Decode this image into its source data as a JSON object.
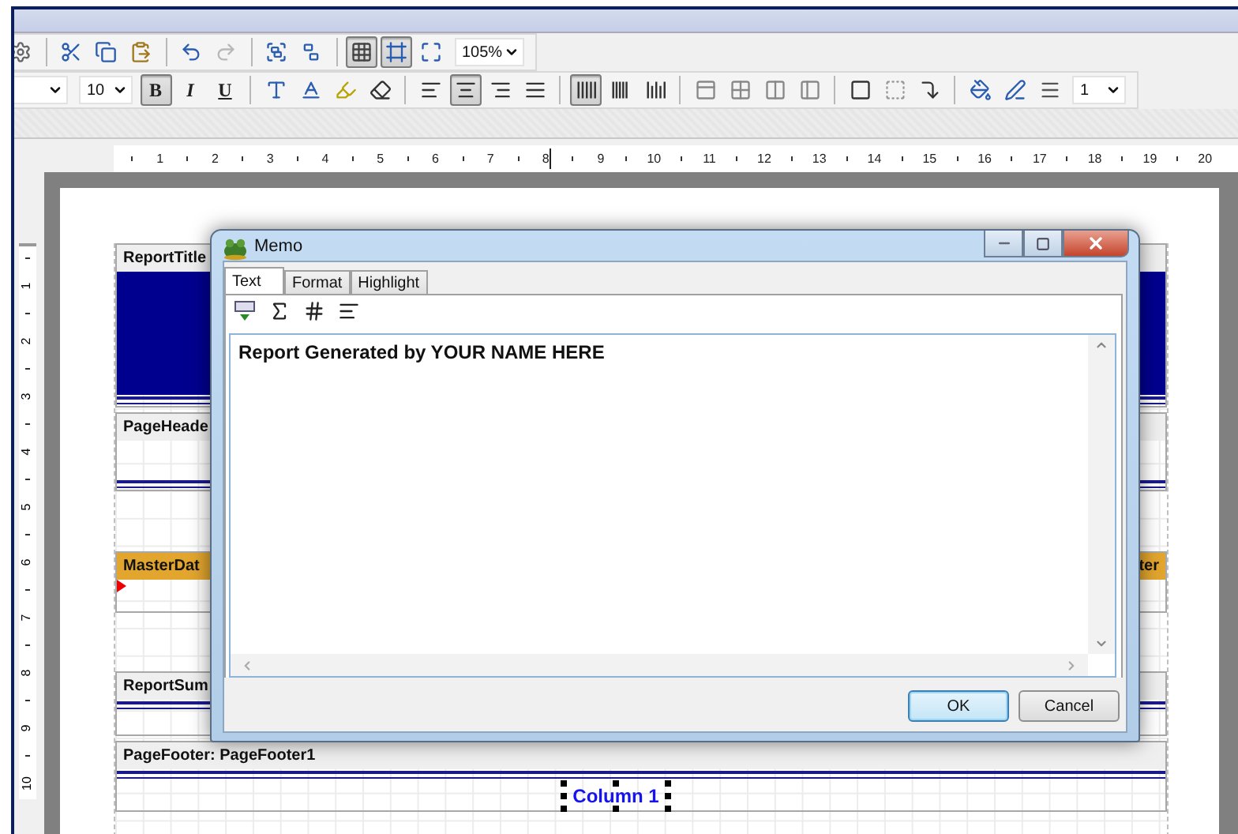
{
  "toolbar_1": {
    "items": [
      {
        "kind": "button",
        "pressed": false,
        "disabled": false
      },
      {
        "kind": "separator"
      },
      {
        "kind": "button",
        "pressed": false,
        "disabled": false
      },
      {
        "kind": "button",
        "pressed": false,
        "disabled": false
      },
      {
        "kind": "button",
        "pressed": false,
        "disabled": false
      },
      {
        "kind": "separator"
      },
      {
        "kind": "button",
        "pressed": false,
        "disabled": false
      },
      {
        "kind": "button",
        "pressed": false,
        "disabled": true
      },
      {
        "kind": "separator"
      },
      {
        "kind": "button",
        "pressed": false,
        "disabled": false
      },
      {
        "kind": "button",
        "pressed": false,
        "disabled": false
      },
      {
        "kind": "separator"
      },
      {
        "kind": "button",
        "pressed": true,
        "disabled": false
      },
      {
        "kind": "button",
        "pressed": true,
        "disabled": false
      },
      {
        "kind": "button",
        "pressed": false,
        "disabled": false
      },
      {
        "kind": "combo",
        "value": "105%"
      }
    ]
  },
  "toolbar_2": {
    "items": [
      {
        "kind": "combo"
      },
      {
        "kind": "combo",
        "value": "10"
      },
      {
        "kind": "button",
        "label": "B",
        "pressed": true
      },
      {
        "kind": "button",
        "label": "I",
        "pressed": false
      },
      {
        "kind": "button",
        "label": "U",
        "pressed": false
      },
      {
        "kind": "separator"
      },
      {
        "kind": "button",
        "pressed": false
      },
      {
        "kind": "button",
        "pressed": false
      },
      {
        "kind": "button",
        "pressed": false
      },
      {
        "kind": "button",
        "pressed": false
      },
      {
        "kind": "separator"
      },
      {
        "kind": "button",
        "pressed": false
      },
      {
        "kind": "button",
        "pressed": true
      },
      {
        "kind": "button",
        "pressed": false
      },
      {
        "kind": "button",
        "pressed": false
      },
      {
        "kind": "separator"
      },
      {
        "kind": "button",
        "pressed": true
      },
      {
        "kind": "button",
        "pressed": false
      },
      {
        "kind": "button",
        "pressed": false
      },
      {
        "kind": "separator"
      },
      {
        "kind": "button",
        "pressed": false
      },
      {
        "kind": "button",
        "pressed": false
      },
      {
        "kind": "button",
        "pressed": false
      },
      {
        "kind": "button",
        "pressed": false
      },
      {
        "kind": "separator"
      },
      {
        "kind": "button",
        "pressed": false
      },
      {
        "kind": "button",
        "pressed": false
      },
      {
        "kind": "button",
        "pressed": false
      },
      {
        "kind": "separator"
      },
      {
        "kind": "button",
        "pressed": false
      },
      {
        "kind": "button",
        "pressed": false
      },
      {
        "kind": "button",
        "pressed": false
      },
      {
        "kind": "combo",
        "value": "1"
      }
    ]
  },
  "ruler": {
    "marks": [
      "1",
      "2",
      "3",
      "4",
      "5",
      "6",
      "7",
      "8",
      "9",
      "10",
      "11",
      "12",
      "13",
      "14",
      "15",
      "16",
      "17",
      "18",
      "19",
      "20"
    ]
  },
  "vertical_ruler": {
    "marks": [
      "1",
      "2",
      "3",
      "4",
      "5",
      "6",
      "7",
      "8",
      "9",
      "10"
    ]
  },
  "bands": [
    {
      "kind": "title",
      "label": "ReportTitle"
    },
    {
      "kind": "header",
      "label": "PageHeade"
    },
    {
      "kind": "data",
      "label": "MasterDat",
      "right_label": "ter"
    },
    {
      "kind": "summary",
      "label": "ReportSum"
    },
    {
      "kind": "footer",
      "label": "PageFooter: PageFooter1",
      "objects": [
        {
          "text": "Column 1",
          "selected": true
        }
      ]
    }
  ],
  "dialog": {
    "title": "Memo",
    "tabs": [
      {
        "label": "Text",
        "selected": true
      },
      {
        "label": "Format",
        "selected": false
      },
      {
        "label": "Highlight",
        "selected": false
      }
    ],
    "text": "Report Generated by YOUR NAME HERE",
    "buttons": [
      {
        "label": "OK",
        "default": true
      },
      {
        "label": "Cancel",
        "default": false
      }
    ]
  }
}
